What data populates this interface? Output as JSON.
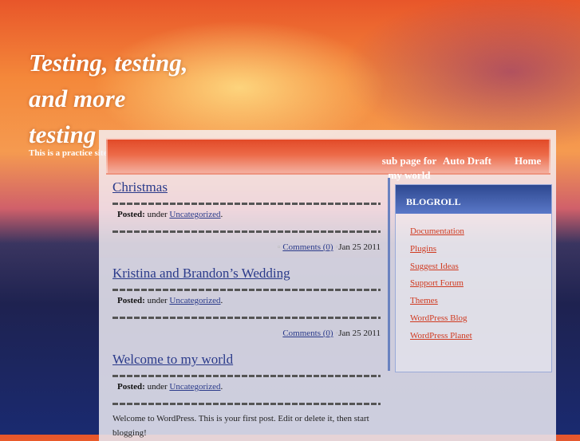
{
  "site": {
    "title": "Testing, testing, and more testing",
    "tagline": "This is a practice site"
  },
  "nav": [
    {
      "label": "sub page for my world"
    },
    {
      "label": "Auto Draft"
    },
    {
      "label": "Home"
    }
  ],
  "posts": [
    {
      "title": "Christmas",
      "posted_label": "Posted:",
      "under": "under",
      "category": "Uncategorized",
      "comments": "Comments (0)",
      "date": "Jan 25 2011"
    },
    {
      "title": "Kristina and Brandon’s Wedding",
      "posted_label": "Posted:",
      "under": "under",
      "category": "Uncategorized",
      "comments": "Comments (0)",
      "date": "Jan 25 2011"
    },
    {
      "title": "Welcome to my world",
      "posted_label": "Posted:",
      "under": "under",
      "category": "Uncategorized",
      "body": "Welcome to WordPress. This is your first post. Edit or delete it, then start blogging!"
    }
  ],
  "blogroll": {
    "title": "BLOGROLL",
    "links": [
      "Documentation",
      "Plugins",
      "Suggest Ideas",
      "Support Forum",
      "Themes",
      "WordPress Blog",
      "WordPress Planet"
    ]
  }
}
